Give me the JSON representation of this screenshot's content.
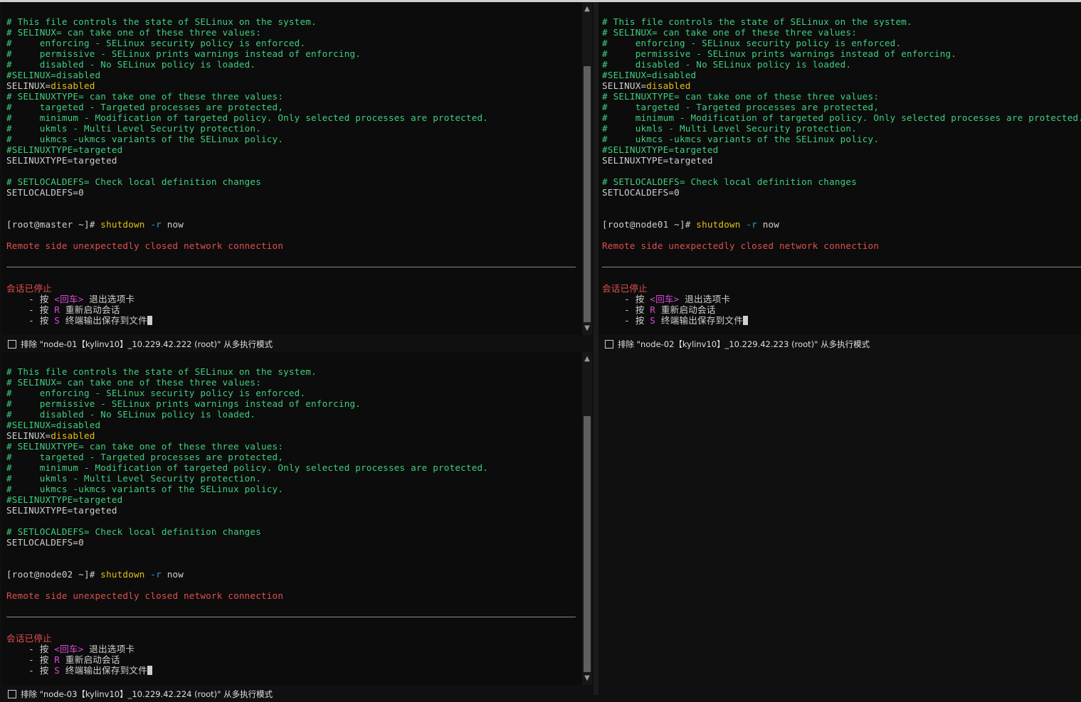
{
  "lines_common": [
    {
      "segs": [
        [
          "# This file controls the state of SELinux on the system.",
          "green"
        ]
      ]
    },
    {
      "segs": [
        [
          "# SELINUX= can take one of these three values:",
          "green"
        ]
      ]
    },
    {
      "segs": [
        [
          "#     enforcing - SELinux security policy is enforced.",
          "green"
        ]
      ]
    },
    {
      "segs": [
        [
          "#     permissive - SELinux prints warnings instead of enforcing.",
          "green"
        ]
      ]
    },
    {
      "segs": [
        [
          "#     disabled - No SELinux policy is loaded.",
          "green"
        ]
      ]
    },
    {
      "segs": [
        [
          "#SELINUX=disabled",
          "green"
        ]
      ]
    },
    {
      "segs": [
        [
          "SELINUX=",
          "white"
        ],
        [
          "disabled",
          "yellow"
        ]
      ]
    },
    {
      "segs": [
        [
          "# SELINUXTYPE= can take one of these three values:",
          "green"
        ]
      ]
    },
    {
      "segs": [
        [
          "#     targeted - Targeted processes are protected,",
          "green"
        ]
      ]
    },
    {
      "segs": [
        [
          "#     minimum - Modification of targeted policy. Only selected processes are protected.",
          "green"
        ]
      ]
    },
    {
      "segs": [
        [
          "#     ukmls - Multi Level Security protection.",
          "green"
        ]
      ]
    },
    {
      "segs": [
        [
          "#     ukmcs -ukmcs variants of the SELinux policy.",
          "green"
        ]
      ]
    },
    {
      "segs": [
        [
          "#SELINUXTYPE=targeted",
          "green"
        ]
      ]
    },
    {
      "segs": [
        [
          "SELINUXTYPE=targeted",
          "white"
        ]
      ]
    },
    {
      "segs": []
    },
    {
      "segs": [
        [
          "# SETLOCALDEFS= Check local definition changes",
          "green"
        ]
      ]
    },
    {
      "segs": [
        [
          "SETLOCALDEFS=0",
          "white"
        ]
      ]
    },
    {
      "segs": []
    },
    {
      "segs": []
    }
  ],
  "panes": [
    {
      "prompt": "[root@master ~]# ",
      "command": "shutdown",
      "flag": "-r",
      "arg": "now",
      "footer": "排除 \"node-01【kylinv10】_10.229.42.222 (root)\" 从多执行模式"
    },
    {
      "prompt": "[root@node01 ~]# ",
      "command": "shutdown",
      "flag": "-r",
      "arg": "now",
      "footer": "排除 \"node-02【kylinv10】_10.229.42.223 (root)\" 从多执行模式"
    },
    {
      "prompt": "[root@node02 ~]# ",
      "command": "shutdown",
      "flag": "-r",
      "arg": "now",
      "footer": "排除 \"node-03【kylinv10】_10.229.42.224 (root)\" 从多执行模式"
    }
  ],
  "disconnect_msg": "Remote side unexpectedly closed network connection",
  "session_stopped": "会话已停止",
  "hint_prefix": "    - 按 ",
  "hint_enter_key": "<回车>",
  "hint_enter_text": " 退出选项卡",
  "hint_r_key": "R",
  "hint_r_text": " 重新启动会话",
  "hint_s_key": "S",
  "hint_s_text": " 终端输出保存到文件",
  "colors": {
    "comment": "#3fcf7c",
    "value": "#e3c014",
    "error": "#e24f4f",
    "key": "#d94ad9",
    "flag": "#3a9dd8"
  }
}
